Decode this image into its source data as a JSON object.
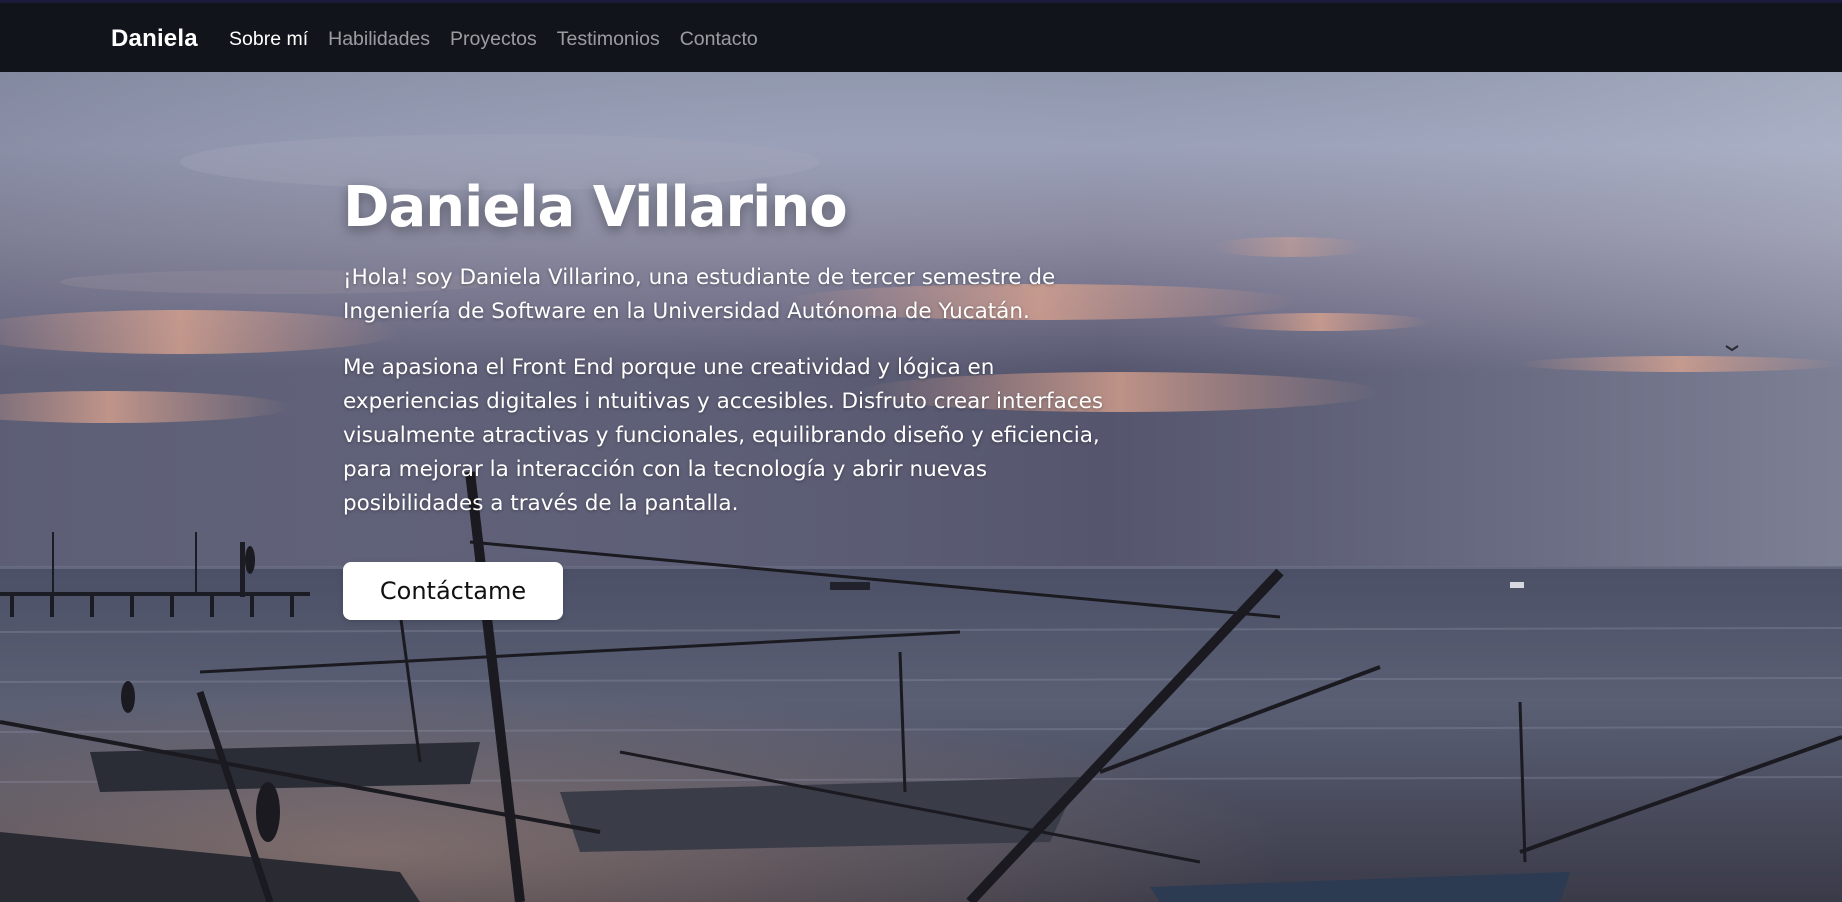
{
  "navbar": {
    "brand": "Daniela",
    "links": [
      {
        "label": "Sobre mí",
        "active": true
      },
      {
        "label": "Habilidades",
        "active": false
      },
      {
        "label": "Proyectos",
        "active": false
      },
      {
        "label": "Testimonios",
        "active": false
      },
      {
        "label": "Contacto",
        "active": false
      }
    ]
  },
  "hero": {
    "title": "Daniela Villarino",
    "paragraphs": [
      "¡Hola! soy Daniela Villarino, una estudiante de tercer semestre de Ingeniería de Software en la Universidad Autónoma de Yucatán.",
      "Me apasiona el Front End porque une creatividad y lógica en experiencias digitales i ntuitivas y accesibles. Disfruto crear interfaces visualmente atractivas y funcionales, equilibrando diseño y eficiencia, para mejorar la interacción con la tecnología y abrir nuevas posibilidades a través de la pantalla."
    ],
    "cta_label": "Contáctame"
  },
  "colors": {
    "navbar_bg": "#12141c",
    "nav_active": "#ffffff",
    "nav_inactive": "#9a9ba2",
    "cta_bg": "#ffffff"
  }
}
